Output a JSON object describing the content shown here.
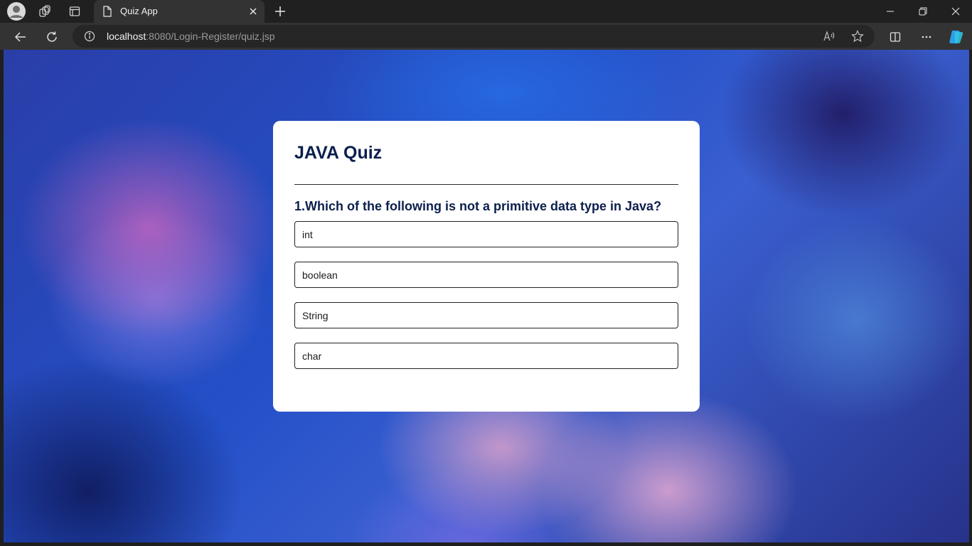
{
  "browser": {
    "tab_title": "Quiz App",
    "url_host": "localhost",
    "url_rest": ":8080/Login-Register/quiz.jsp"
  },
  "quiz": {
    "title": "JAVA Quiz",
    "question": "1.Which of the following is not a primitive data type in Java?",
    "options": [
      "int",
      "boolean",
      "String",
      "char"
    ]
  },
  "colors": {
    "title": "#0c1f4d",
    "card": "#ffffff"
  },
  "icons": [
    "profile-icon",
    "workspaces-icon",
    "tab-actions-icon",
    "page-icon",
    "close-icon",
    "new-tab-icon",
    "minimize-icon",
    "restore-icon",
    "close-window-icon",
    "back-icon",
    "refresh-icon",
    "info-icon",
    "read-aloud-icon",
    "favorite-icon",
    "split-screen-icon",
    "more-icon",
    "copilot-icon"
  ]
}
